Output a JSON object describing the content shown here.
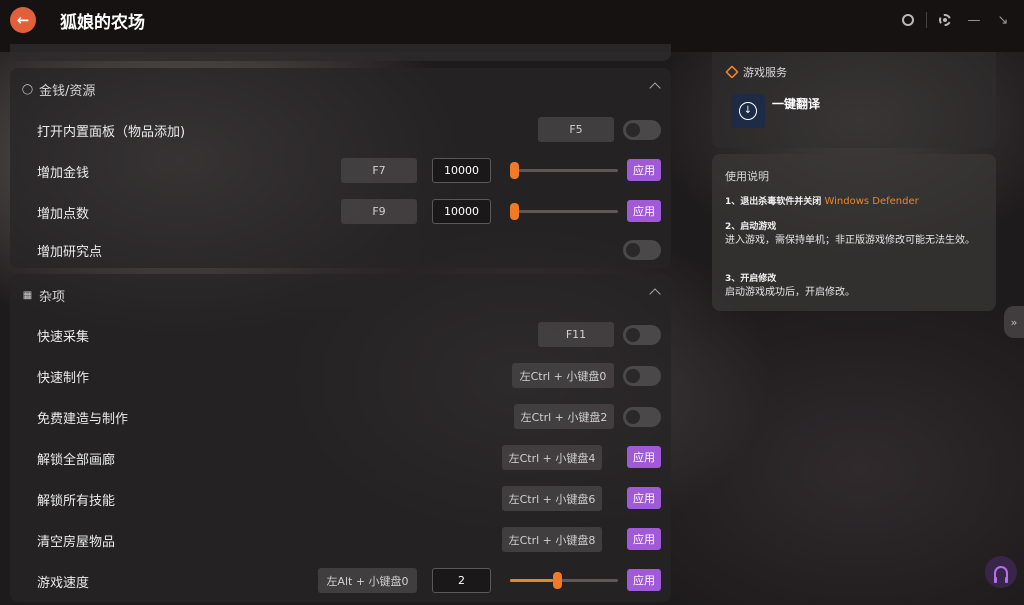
{
  "window": {
    "back_icon": "back-arrow-icon",
    "title": "狐娘的农场",
    "controls": [
      "avatar-icon",
      "settings-icon",
      "minimize-icon",
      "collapse-icon"
    ]
  },
  "sections": {
    "money": {
      "title": "金钱/资源",
      "rows": [
        {
          "label": "打开内置面板（物品添加)",
          "hotkey": "F5",
          "control": "toggle",
          "enabled": false
        },
        {
          "label": "增加金钱",
          "hotkey": "F7",
          "value": "10000",
          "slider_fraction": 0.0,
          "apply": "应用"
        },
        {
          "label": "增加点数",
          "hotkey": "F9",
          "value": "10000",
          "slider_fraction": 0.0,
          "apply": "应用"
        },
        {
          "label": "增加研究点",
          "control": "toggle",
          "enabled": false
        }
      ]
    },
    "misc": {
      "title": "杂项",
      "rows": [
        {
          "label": "快速采集",
          "hotkey": "F11",
          "control": "toggle",
          "enabled": false
        },
        {
          "label": "快速制作",
          "hotkey": "左Ctrl + 小键盘0",
          "control": "toggle",
          "enabled": false
        },
        {
          "label": "免费建造与制作",
          "hotkey": "左Ctrl + 小键盘2",
          "control": "toggle",
          "enabled": false
        },
        {
          "label": "解锁全部画廊",
          "hotkey": "左Ctrl + 小键盘4",
          "apply": "应用"
        },
        {
          "label": "解锁所有技能",
          "hotkey": "左Ctrl + 小键盘6",
          "apply": "应用"
        },
        {
          "label": "清空房屋物品",
          "hotkey": "左Ctrl + 小键盘8",
          "apply": "应用"
        },
        {
          "label": "游戏速度",
          "hotkey": "左Alt + 小键盘0",
          "value": "2",
          "slider_fraction": 0.4,
          "apply": "应用"
        }
      ]
    }
  },
  "service": {
    "title": "游戏服务",
    "item_label": "一键翻译"
  },
  "guide": {
    "title": "使用说明",
    "step1_label": "1、退出杀毒软件并关闭",
    "step1_highlight": "Windows Defender",
    "step2_label": "2、启动游戏",
    "step2_text": "进入游戏，需保持单机；非正版游戏修改可能无法生效。",
    "step3_label": "3、开启修改",
    "step3_text": "启动游戏成功后，开启修改。"
  },
  "colors": {
    "accent_purple": "#a05ad8",
    "accent_orange": "#e8872c",
    "back_button": "#e0603a"
  }
}
